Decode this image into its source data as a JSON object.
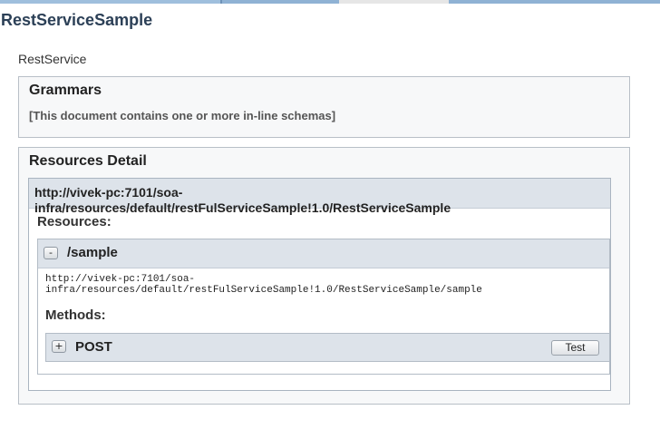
{
  "page": {
    "title": "RestServiceSample",
    "service_name": "RestService"
  },
  "grammars": {
    "title": "Grammars",
    "text": "[This document contains one or more in-line schemas]"
  },
  "resources_detail": {
    "title": "Resources Detail",
    "base_url": "http://vivek-pc:7101/soa-infra/resources/default/restFulServiceSample!1.0/RestServiceSample",
    "resources_label": "Resources:",
    "resource": {
      "toggle": "-",
      "path": "/sample",
      "url": "http://vivek-pc:7101/soa-infra/resources/default/restFulServiceSample!1.0/RestServiceSample/sample",
      "methods_label": "Methods:",
      "method": {
        "toggle": "+",
        "name": "POST",
        "test_label": "Test"
      }
    }
  },
  "colors": {
    "title": "#2c4057",
    "header_bg": "#dde3ea",
    "panel_bg": "#f7f8f9",
    "border": "#b8bfc7"
  }
}
